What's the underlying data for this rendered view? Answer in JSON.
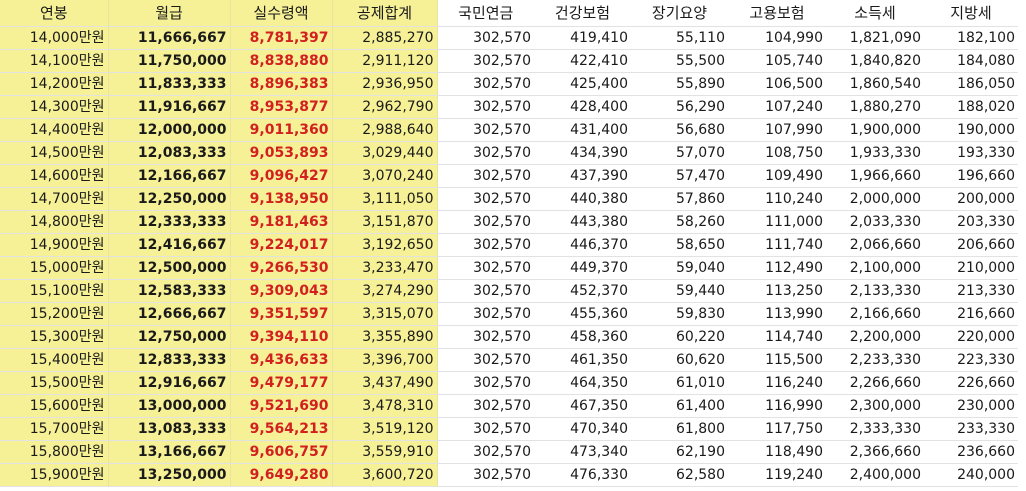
{
  "headers": [
    "연봉",
    "월급",
    "실수령액",
    "공제합계",
    "국민연금",
    "건강보험",
    "장기요양",
    "고용보험",
    "소득세",
    "지방세"
  ],
  "rows": [
    [
      "14,000만원",
      "11,666,667",
      "8,781,397",
      "2,885,270",
      "302,570",
      "419,410",
      "55,110",
      "104,990",
      "1,821,090",
      "182,100"
    ],
    [
      "14,100만원",
      "11,750,000",
      "8,838,880",
      "2,911,120",
      "302,570",
      "422,410",
      "55,500",
      "105,740",
      "1,840,820",
      "184,080"
    ],
    [
      "14,200만원",
      "11,833,333",
      "8,896,383",
      "2,936,950",
      "302,570",
      "425,400",
      "55,890",
      "106,500",
      "1,860,540",
      "186,050"
    ],
    [
      "14,300만원",
      "11,916,667",
      "8,953,877",
      "2,962,790",
      "302,570",
      "428,400",
      "56,290",
      "107,240",
      "1,880,270",
      "188,020"
    ],
    [
      "14,400만원",
      "12,000,000",
      "9,011,360",
      "2,988,640",
      "302,570",
      "431,400",
      "56,680",
      "107,990",
      "1,900,000",
      "190,000"
    ],
    [
      "14,500만원",
      "12,083,333",
      "9,053,893",
      "3,029,440",
      "302,570",
      "434,390",
      "57,070",
      "108,750",
      "1,933,330",
      "193,330"
    ],
    [
      "14,600만원",
      "12,166,667",
      "9,096,427",
      "3,070,240",
      "302,570",
      "437,390",
      "57,470",
      "109,490",
      "1,966,660",
      "196,660"
    ],
    [
      "14,700만원",
      "12,250,000",
      "9,138,950",
      "3,111,050",
      "302,570",
      "440,380",
      "57,860",
      "110,240",
      "2,000,000",
      "200,000"
    ],
    [
      "14,800만원",
      "12,333,333",
      "9,181,463",
      "3,151,870",
      "302,570",
      "443,380",
      "58,260",
      "111,000",
      "2,033,330",
      "203,330"
    ],
    [
      "14,900만원",
      "12,416,667",
      "9,224,017",
      "3,192,650",
      "302,570",
      "446,370",
      "58,650",
      "111,740",
      "2,066,660",
      "206,660"
    ],
    [
      "15,000만원",
      "12,500,000",
      "9,266,530",
      "3,233,470",
      "302,570",
      "449,370",
      "59,040",
      "112,490",
      "2,100,000",
      "210,000"
    ],
    [
      "15,100만원",
      "12,583,333",
      "9,309,043",
      "3,274,290",
      "302,570",
      "452,370",
      "59,440",
      "113,250",
      "2,133,330",
      "213,330"
    ],
    [
      "15,200만원",
      "12,666,667",
      "9,351,597",
      "3,315,070",
      "302,570",
      "455,360",
      "59,830",
      "113,990",
      "2,166,660",
      "216,660"
    ],
    [
      "15,300만원",
      "12,750,000",
      "9,394,110",
      "3,355,890",
      "302,570",
      "458,360",
      "60,220",
      "114,740",
      "2,200,000",
      "220,000"
    ],
    [
      "15,400만원",
      "12,833,333",
      "9,436,633",
      "3,396,700",
      "302,570",
      "461,350",
      "60,620",
      "115,500",
      "2,233,330",
      "223,330"
    ],
    [
      "15,500만원",
      "12,916,667",
      "9,479,177",
      "3,437,490",
      "302,570",
      "464,350",
      "61,010",
      "116,240",
      "2,266,660",
      "226,660"
    ],
    [
      "15,600만원",
      "13,000,000",
      "9,521,690",
      "3,478,310",
      "302,570",
      "467,350",
      "61,400",
      "116,990",
      "2,300,000",
      "230,000"
    ],
    [
      "15,700만원",
      "13,083,333",
      "9,564,213",
      "3,519,120",
      "302,570",
      "470,340",
      "61,800",
      "117,750",
      "2,333,330",
      "233,330"
    ],
    [
      "15,800만원",
      "13,166,667",
      "9,606,757",
      "3,559,910",
      "302,570",
      "473,340",
      "62,190",
      "118,490",
      "2,366,660",
      "236,660"
    ],
    [
      "15,900만원",
      "13,250,000",
      "9,649,280",
      "3,600,720",
      "302,570",
      "476,330",
      "62,580",
      "119,240",
      "2,400,000",
      "240,000"
    ]
  ],
  "colors": {
    "highlight": "#f6f196",
    "net_pay_text": "#d21f1f"
  }
}
